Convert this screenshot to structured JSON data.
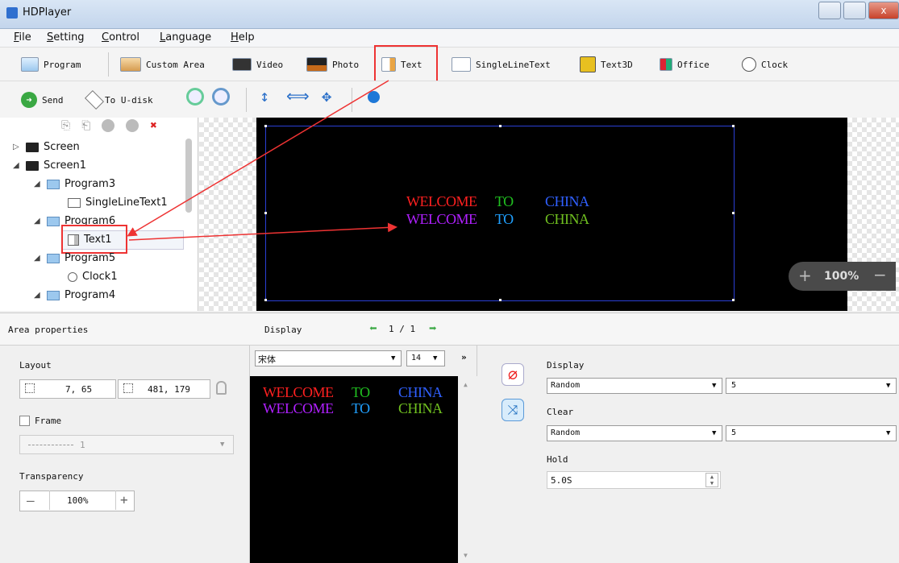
{
  "window": {
    "title": "HDPlayer"
  },
  "menu": [
    "File",
    "Setting",
    "Control",
    "Language",
    "Help"
  ],
  "toolbar1": {
    "program": "Program",
    "custom_area": "Custom Area",
    "video": "Video",
    "photo": "Photo",
    "text": "Text",
    "single_line_text": "SingleLineText",
    "text3d": "Text3D",
    "office": "Office",
    "clock": "Clock"
  },
  "toolbar2": {
    "send": "Send",
    "to_udisk": "To U-disk"
  },
  "tree": {
    "items": [
      {
        "label": "Screen"
      },
      {
        "label": "Screen1"
      },
      {
        "label": "Program3"
      },
      {
        "label": "SingleLineText1"
      },
      {
        "label": "Program6"
      },
      {
        "label": "Text1"
      },
      {
        "label": "Program5"
      },
      {
        "label": "Clock1"
      },
      {
        "label": "Program4"
      }
    ]
  },
  "canvas": {
    "lines": [
      [
        "WELCOME",
        "TO",
        "CHINA"
      ],
      [
        "WELCOME",
        "TO",
        "CHINA"
      ]
    ],
    "zoom": "100%",
    "colors": {
      "line1": [
        "#ff2020",
        "#20c020",
        "#3060ff"
      ],
      "line2": [
        "#b020ff",
        "#20a0ff",
        "#70c020"
      ]
    }
  },
  "area_properties": {
    "header": "Area properties",
    "layout_label": "Layout",
    "position": "7, 65",
    "size": "481, 179",
    "frame_label": "Frame",
    "frame_value": "1",
    "transparency_label": "Transparency",
    "transparency_value": "100%"
  },
  "display_panel": {
    "header": "Display",
    "page": "1 / 1",
    "font": "宋体",
    "font_size": "14"
  },
  "effects": {
    "display_label": "Display",
    "display_effect": "Random",
    "display_speed": "5",
    "clear_label": "Clear",
    "clear_effect": "Random",
    "clear_speed": "5",
    "hold_label": "Hold",
    "hold_value": "5.0S"
  }
}
